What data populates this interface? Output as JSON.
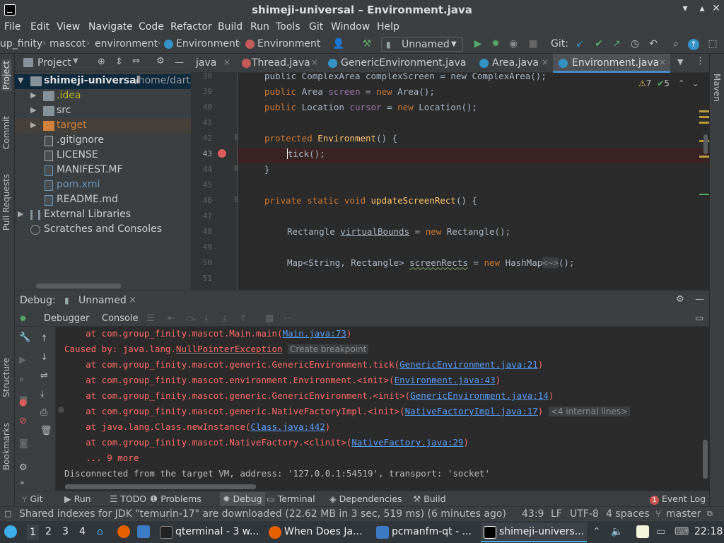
{
  "window": {
    "title": "shimeji-universal – Environment.java",
    "controls": [
      "▾",
      "▴",
      "✕"
    ]
  },
  "menu": [
    "File",
    "Edit",
    "View",
    "Navigate",
    "Code",
    "Refactor",
    "Build",
    "Run",
    "Tools",
    "Git",
    "Window",
    "Help"
  ],
  "breadcrumbs": [
    "up_finity",
    "mascot",
    "environment",
    "Environment",
    "Environment"
  ],
  "toolbar": {
    "run_config": "Unnamed",
    "git_label": "Git:"
  },
  "left_stripe": [
    "Project",
    "Commit",
    "Pull Requests",
    "Structure",
    "Bookmarks"
  ],
  "right_stripe": [
    "Maven"
  ],
  "project": {
    "header": "Project",
    "root_name": "shimeji-universal",
    "root_path": "/home/dartz",
    "items": [
      {
        "name": ".idea"
      },
      {
        "name": "src"
      },
      {
        "name": "target"
      },
      {
        "name": ".gitignore"
      },
      {
        "name": "LICENSE"
      },
      {
        "name": "MANIFEST.MF"
      },
      {
        "name": "pom.xml"
      },
      {
        "name": "README.md"
      },
      {
        "name": "External Libraries"
      },
      {
        "name": "Scratches and Consoles"
      }
    ]
  },
  "editor": {
    "tabs": [
      {
        "label": "java"
      },
      {
        "label": "Thread.java"
      },
      {
        "label": "GenericEnvironment.java"
      },
      {
        "label": "Area.java"
      },
      {
        "label": "Environment.java",
        "active": true
      }
    ],
    "inspections": {
      "warnings": "7",
      "ok": "5"
    },
    "line_numbers": [
      "38",
      "39",
      "40",
      "41",
      "42",
      "43",
      "44",
      "45",
      "46",
      "47",
      "48",
      "49",
      "50",
      "51"
    ],
    "lines": {
      "l38": "public ComplexArea complexScreen = new ComplexArea();",
      "l39a": "public ",
      "l39b": "Area ",
      "l39c": "screen",
      "l39d": " = ",
      "l39e": "new ",
      "l39f": "Area();",
      "l40a": "public ",
      "l40b": "Location ",
      "l40c": "cursor",
      "l40d": " = ",
      "l40e": "new ",
      "l40f": "Location();",
      "l42a": "protected ",
      "l42b": "Environment",
      "l42c": "() {",
      "l43": "tick();",
      "l44": "}",
      "l46a": "private static void ",
      "l46b": "updateScreenRect",
      "l46c": "() {",
      "l48a": "Rectangle ",
      "l48b": "virtualBounds",
      "l48c": " = ",
      "l48d": "new ",
      "l48e": "Rectangle();",
      "l50a": "Map<String, Rectangle> ",
      "l50b": "screenRects",
      "l50c": " = ",
      "l50d": "new ",
      "l50e": "HashMap",
      "l50f": "<~>",
      "l50g": "();"
    }
  },
  "debug": {
    "label": "Debug:",
    "session": "Unnamed",
    "tabs": [
      "Debugger",
      "Console"
    ],
    "console": {
      "line1_prefix": "    at com.group_finity.mascot.Main.main(",
      "line1_link": "Main.java:73",
      "line1_suffix": ")",
      "caused_prefix": "Caused by: java.lang.",
      "caused_exc": "NullPointerException",
      "caused_hint": "Create breakpoint",
      "l3_prefix": "    at com.group_finity.mascot.generic.GenericEnvironment.tick(",
      "l3_link": "GenericEnvironment.java:21",
      "l4_prefix": "    at com.group_finity.mascot.environment.Environment.<init>(",
      "l4_link": "Environment.java:43",
      "l5_prefix": "    at com.group_finity.mascot.generic.GenericEnvironment.<init>(",
      "l5_link": "GenericEnvironment.java:14",
      "l6_prefix": "    at com.group_finity.mascot.generic.NativeFactoryImpl.<init>(",
      "l6_link": "NativeFactoryImpl.java:17",
      "l6_hint": "<4 internal lines>",
      "l7_prefix": "    at java.lang.Class.newInstance(",
      "l7_link": "Class.java:442",
      "l8_prefix": "    at com.group_finity.mascot.NativeFactory.<clinit>(",
      "l8_link": "NativeFactory.java:29",
      "close": ")",
      "more": "    ... 9 more",
      "disconnected": "Disconnected from the target VM, address: '127.0.0.1:54519', transport: 'socket'"
    }
  },
  "bottom_tabs": [
    "Git",
    "Run",
    "TODO",
    "Problems",
    "Debug",
    "Terminal",
    "Dependencies",
    "Build"
  ],
  "event_log": {
    "count": "1",
    "label": "Event Log"
  },
  "status": {
    "message": "Shared indexes for JDK \"temurin-17\" are downloaded (22.62 MB in 3 sec, 519 ms) (6 minutes ago)",
    "position": "43:9",
    "line_sep": "LF",
    "encoding": "UTF-8",
    "indent": "4 spaces",
    "branch": "master"
  },
  "taskbar": {
    "desktops": [
      "1",
      "2",
      "3",
      "4"
    ],
    "tasks": [
      "qterminal - 3 w...",
      "When Does Ja...",
      "pcmanfm-qt - ...",
      "shimeji-univers..."
    ],
    "clock": "22:18"
  }
}
